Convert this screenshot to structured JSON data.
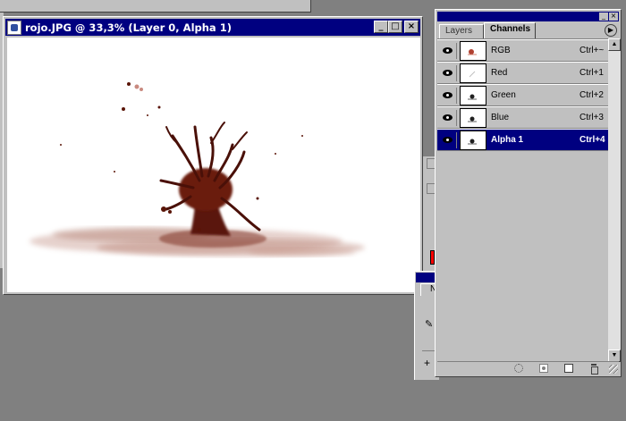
{
  "document": {
    "title": "rojo.JPG @ 33,3% (Layer 0, Alpha 1)",
    "buttons": {
      "minimize": "_",
      "maximize": "□",
      "close": "×"
    }
  },
  "palette": {
    "tabs": [
      {
        "label": "Layers"
      },
      {
        "label": "Channels"
      }
    ],
    "menu_icon": "palette-menu-arrow",
    "channels": [
      {
        "name": "RGB",
        "shortcut": "Ctrl+~",
        "visible": true,
        "selected": false
      },
      {
        "name": "Red",
        "shortcut": "Ctrl+1",
        "visible": true,
        "selected": false
      },
      {
        "name": "Green",
        "shortcut": "Ctrl+2",
        "visible": true,
        "selected": false
      },
      {
        "name": "Blue",
        "shortcut": "Ctrl+3",
        "visible": true,
        "selected": false
      },
      {
        "name": "Alpha 1",
        "shortcut": "Ctrl+4",
        "visible": true,
        "selected": true
      }
    ],
    "footer_icons": [
      "load-selection-icon",
      "save-selection-icon",
      "new-channel-icon",
      "trash-icon"
    ]
  },
  "navigator": {
    "tab_label": "N"
  },
  "colors": {
    "titlebar": "#000080",
    "window_face": "#c0c0c0",
    "desktop": "#808080",
    "paint": "#8b2a1a"
  }
}
